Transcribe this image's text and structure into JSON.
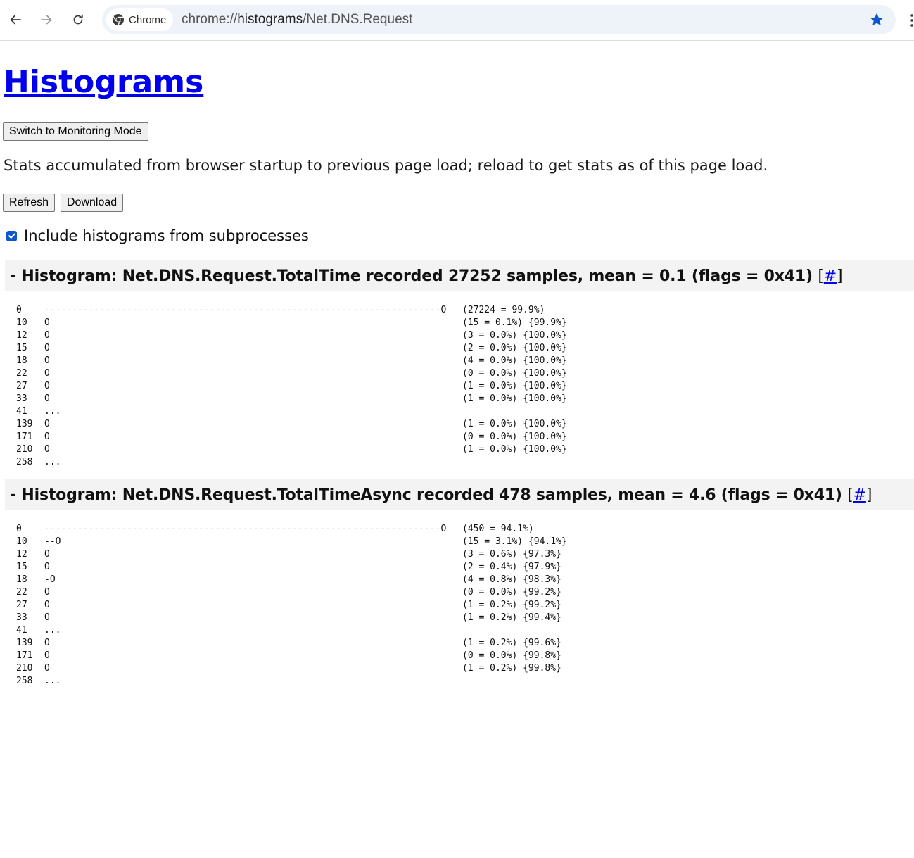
{
  "browser": {
    "chip_label": "Chrome",
    "url_scheme": "chrome://",
    "url_host": "histograms",
    "url_path": "/Net.DNS.Request",
    "accent_color": "#0b57d0"
  },
  "page": {
    "title": "Histograms",
    "monitoring_button": "Switch to Monitoring Mode",
    "stats_text": "Stats accumulated from browser startup to previous page load; reload to get stats as of this page load.",
    "refresh_button": "Refresh",
    "download_button": "Download",
    "include_subprocesses_label": "Include histograms from subprocesses",
    "include_subprocesses_checked": true
  },
  "histograms": [
    {
      "header": "- Histogram: Net.DNS.Request.TotalTime recorded 27252 samples, mean = 0.1 (flags = 0x41)",
      "bracket_open": "[",
      "link": "#",
      "bracket_close": "]",
      "rows": [
        {
          "bucket": "0",
          "bar": "------------------------------------------------------------------------O",
          "count": "(27224 = 99.9%)"
        },
        {
          "bucket": "10",
          "bar": "O",
          "count": "(15 = 0.1%) {99.9%}"
        },
        {
          "bucket": "12",
          "bar": "O",
          "count": "(3 = 0.0%) {100.0%}"
        },
        {
          "bucket": "15",
          "bar": "O",
          "count": "(2 = 0.0%) {100.0%}"
        },
        {
          "bucket": "18",
          "bar": "O",
          "count": "(4 = 0.0%) {100.0%}"
        },
        {
          "bucket": "22",
          "bar": "O",
          "count": "(0 = 0.0%) {100.0%}"
        },
        {
          "bucket": "27",
          "bar": "O",
          "count": "(1 = 0.0%) {100.0%}"
        },
        {
          "bucket": "33",
          "bar": "O",
          "count": "(1 = 0.0%) {100.0%}"
        },
        {
          "bucket": "41",
          "bar": "...",
          "count": ""
        },
        {
          "bucket": "139",
          "bar": "O",
          "count": "(1 = 0.0%) {100.0%}"
        },
        {
          "bucket": "171",
          "bar": "O",
          "count": "(0 = 0.0%) {100.0%}"
        },
        {
          "bucket": "210",
          "bar": "O",
          "count": "(1 = 0.0%) {100.0%}"
        },
        {
          "bucket": "258",
          "bar": "...",
          "count": ""
        }
      ]
    },
    {
      "header": "- Histogram: Net.DNS.Request.TotalTimeAsync recorded 478 samples, mean = 4.6 (flags = 0x41)",
      "bracket_open": "[",
      "link": "#",
      "bracket_close": "]",
      "rows": [
        {
          "bucket": "0",
          "bar": "------------------------------------------------------------------------O",
          "count": "(450 = 94.1%)"
        },
        {
          "bucket": "10",
          "bar": "--O",
          "count": "(15 = 3.1%) {94.1%}"
        },
        {
          "bucket": "12",
          "bar": "O",
          "count": "(3 = 0.6%) {97.3%}"
        },
        {
          "bucket": "15",
          "bar": "O",
          "count": "(2 = 0.4%) {97.9%}"
        },
        {
          "bucket": "18",
          "bar": "-O",
          "count": "(4 = 0.8%) {98.3%}"
        },
        {
          "bucket": "22",
          "bar": "O",
          "count": "(0 = 0.0%) {99.2%}"
        },
        {
          "bucket": "27",
          "bar": "O",
          "count": "(1 = 0.2%) {99.2%}"
        },
        {
          "bucket": "33",
          "bar": "O",
          "count": "(1 = 0.2%) {99.4%}"
        },
        {
          "bucket": "41",
          "bar": "...",
          "count": ""
        },
        {
          "bucket": "139",
          "bar": "O",
          "count": "(1 = 0.2%) {99.6%}"
        },
        {
          "bucket": "171",
          "bar": "O",
          "count": "(0 = 0.0%) {99.8%}"
        },
        {
          "bucket": "210",
          "bar": "O",
          "count": "(1 = 0.2%) {99.8%}"
        },
        {
          "bucket": "258",
          "bar": "...",
          "count": ""
        }
      ]
    }
  ]
}
